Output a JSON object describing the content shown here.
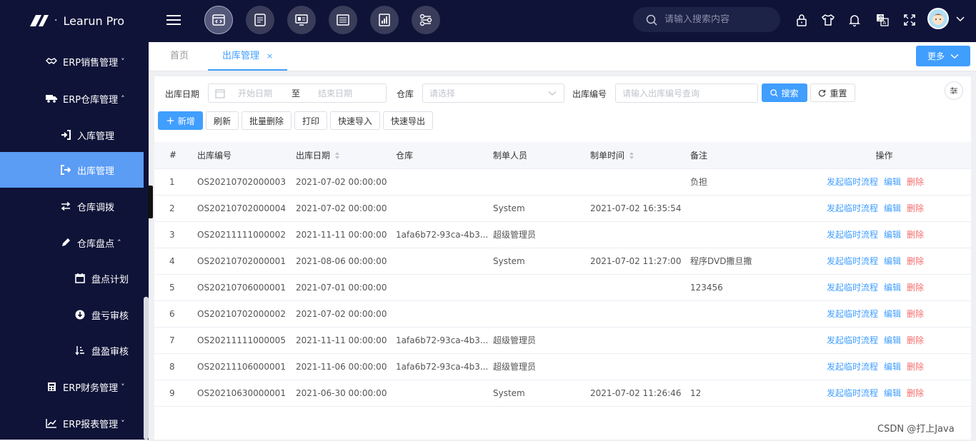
{
  "app": {
    "title": "Learun Pro",
    "logo_dot": "·"
  },
  "header": {
    "search_placeholder": "请输入搜索内容",
    "modules": [
      "code-window-icon",
      "form-icon",
      "monitor-icon",
      "news-icon",
      "report-icon",
      "flow-icon"
    ]
  },
  "sidebar": {
    "items": [
      {
        "label": "ERP销售管理",
        "icon": "handshake-icon",
        "arrow": "˅",
        "level": 1
      },
      {
        "label": "ERP仓库管理",
        "icon": "truck-icon",
        "arrow": "˄",
        "level": 1
      },
      {
        "label": "入库管理",
        "icon": "sign-in-icon",
        "arrow": "",
        "level": 2
      },
      {
        "label": "出库管理",
        "icon": "sign-out-icon",
        "arrow": "",
        "level": 2,
        "active": true
      },
      {
        "label": "仓库调拨",
        "icon": "exchange-icon",
        "arrow": "",
        "level": 2
      },
      {
        "label": "仓库盘点",
        "icon": "pencil-icon",
        "arrow": "˄",
        "level": 2
      },
      {
        "label": "盘点计划",
        "icon": "calendar-icon",
        "arrow": "",
        "level": 3
      },
      {
        "label": "盘亏审核",
        "icon": "download-circle-icon",
        "arrow": "",
        "level": 3
      },
      {
        "label": "盘盈审核",
        "icon": "sort-amount-icon",
        "arrow": "",
        "level": 3
      },
      {
        "label": "ERP财务管理",
        "icon": "calculator-icon",
        "arrow": "˅",
        "level": 1
      },
      {
        "label": "ERP报表管理",
        "icon": "line-chart-icon",
        "arrow": "˅",
        "level": 1
      }
    ]
  },
  "tabs": {
    "home": "首页",
    "current": "出库管理",
    "close": "×",
    "more": "更多"
  },
  "filters": {
    "date_label": "出库日期",
    "start_placeholder": "开始日期",
    "to": "至",
    "end_placeholder": "结束日期",
    "warehouse_label": "仓库",
    "warehouse_placeholder": "请选择",
    "code_label": "出库编号",
    "code_placeholder": "请输入出库编号查询",
    "search": "搜索",
    "reset": "重置"
  },
  "toolbar": {
    "add": "新增",
    "refresh": "刷新",
    "batch_delete": "批量删除",
    "print": "打印",
    "quick_import": "快速导入",
    "quick_export": "快速导出"
  },
  "table": {
    "headers": [
      "#",
      "出库编号",
      "出库日期",
      "仓库",
      "制单人员",
      "制单时间",
      "备注",
      "操作"
    ],
    "rows": [
      [
        "1",
        "OS20210702000003",
        "2021-07-02 00:00:00",
        "",
        "",
        "",
        "负担"
      ],
      [
        "2",
        "OS20210702000004",
        "2021-07-02 00:00:00",
        "",
        "System",
        "2021-07-02 16:35:54",
        ""
      ],
      [
        "3",
        "OS20211111000002",
        "2021-11-11 00:00:00",
        "1afa6b72-93ca-4b3...",
        "超级管理员",
        "",
        ""
      ],
      [
        "4",
        "OS20210702000001",
        "2021-08-06 00:00:00",
        "",
        "System",
        "2021-07-02 11:27:00",
        "程序DVD撒旦撒"
      ],
      [
        "5",
        "OS20210706000001",
        "2021-07-01 00:00:00",
        "",
        "",
        "",
        "123456"
      ],
      [
        "6",
        "OS20210702000002",
        "2021-07-02 00:00:00",
        "",
        "",
        "",
        ""
      ],
      [
        "7",
        "OS20211111000005",
        "2021-11-11 00:00:00",
        "1afa6b72-93ca-4b3...",
        "超级管理员",
        "",
        ""
      ],
      [
        "8",
        "OS20211106000001",
        "2021-11-06 00:00:00",
        "1afa6b72-93ca-4b3...",
        "超级管理员",
        "",
        ""
      ],
      [
        "9",
        "OS20210630000001",
        "2021-06-30 00:00:00",
        "",
        "System",
        "2021-07-02 11:26:46",
        "12"
      ]
    ],
    "actions": {
      "flow": "发起临时流程",
      "edit": "编辑",
      "delete": "删除"
    }
  },
  "watermark": "CSDN @打上Java",
  "colors": {
    "dark_bg": "#0f1338",
    "accent": "#409eff",
    "active_menu": "#5b9cf5",
    "danger": "#f56c6c"
  }
}
